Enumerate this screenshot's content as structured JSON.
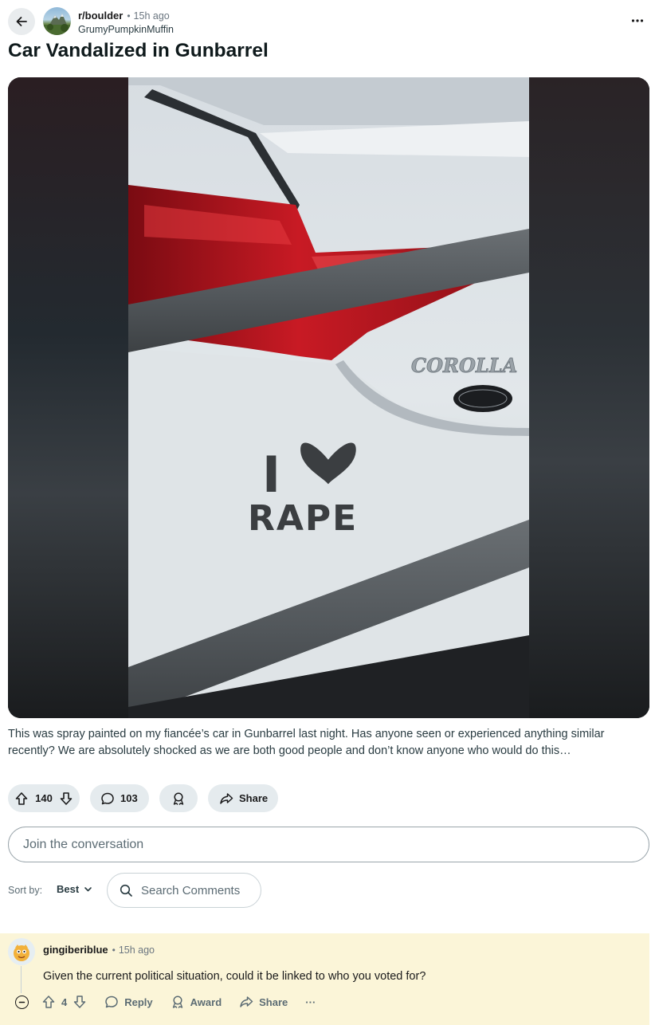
{
  "header": {
    "subreddit": "r/boulder",
    "age": "15h ago",
    "author": "GrumyPumpkinMuffin",
    "separator": "•"
  },
  "post": {
    "title": "Car Vandalized in Gunbarrel",
    "body": "This was spray painted on my fiancée’s car in Gunbarrel last night. Has anyone seen or experienced anything similar recently? We are absolutely shocked as we are both good people and don’t know anyone who would do this…",
    "image_text": {
      "badge": "COROLLA",
      "graffiti_line1": "I",
      "graffiti_line2": "RAPE"
    }
  },
  "actions": {
    "upvotes": "140",
    "comments": "103",
    "share_label": "Share"
  },
  "composer": {
    "placeholder": "Join the conversation"
  },
  "sort": {
    "label": "Sort by:",
    "value": "Best",
    "search_placeholder": "Search Comments"
  },
  "comment": {
    "user": "gingiberiblue",
    "age": "15h ago",
    "separator": "•",
    "body": "Given the current political situation, could it be linked to who you voted for?",
    "votes": "4",
    "reply_label": "Reply",
    "award_label": "Award",
    "share_label": "Share",
    "more_label": "···"
  },
  "colors": {
    "pill_bg": "#e5ebee",
    "comment_highlight": "#fbf5d8",
    "text_secondary": "#5c6c74"
  }
}
